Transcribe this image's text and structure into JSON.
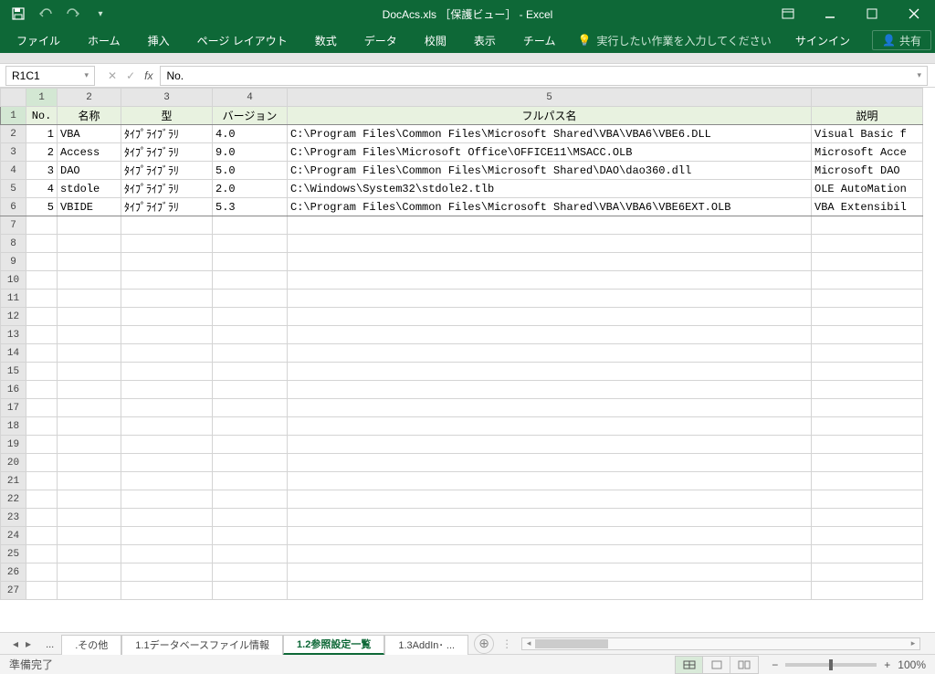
{
  "title": "DocAcs.xls ［保護ビュー］ - Excel",
  "qat": {
    "save": "保存",
    "undo": "元に戻す",
    "redo": "やり直し"
  },
  "ribbon": {
    "tabs": [
      "ファイル",
      "ホーム",
      "挿入",
      "ページ レイアウト",
      "数式",
      "データ",
      "校閲",
      "表示",
      "チーム"
    ],
    "tellme": "実行したい作業を入力してください",
    "signin": "サインイン",
    "share": "共有"
  },
  "namebox": "R1C1",
  "formula": "No.",
  "columns": [
    "1",
    "2",
    "3",
    "4",
    "5"
  ],
  "headers": {
    "no": "No.",
    "name": "名称",
    "type": "型",
    "ver": "バージョン",
    "path": "フルパス名",
    "desc": "説明"
  },
  "rows": [
    {
      "no": "1",
      "name": "VBA",
      "type": "ﾀｲﾌﾟﾗｲﾌﾞﾗﾘ",
      "ver": "4.0",
      "path": "C:\\Program Files\\Common Files\\Microsoft Shared\\VBA\\VBA6\\VBE6.DLL",
      "desc": "Visual Basic f"
    },
    {
      "no": "2",
      "name": "Access",
      "type": "ﾀｲﾌﾟﾗｲﾌﾞﾗﾘ",
      "ver": "9.0",
      "path": "C:\\Program Files\\Microsoft Office\\OFFICE11\\MSACC.OLB",
      "desc": "Microsoft Acce"
    },
    {
      "no": "3",
      "name": "DAO",
      "type": "ﾀｲﾌﾟﾗｲﾌﾞﾗﾘ",
      "ver": "5.0",
      "path": "C:\\Program Files\\Common Files\\Microsoft Shared\\DAO\\dao360.dll",
      "desc": "Microsoft DAO"
    },
    {
      "no": "4",
      "name": "stdole",
      "type": "ﾀｲﾌﾟﾗｲﾌﾞﾗﾘ",
      "ver": "2.0",
      "path": "C:\\Windows\\System32\\stdole2.tlb",
      "desc": "OLE AutoMation"
    },
    {
      "no": "5",
      "name": "VBIDE",
      "type": "ﾀｲﾌﾟﾗｲﾌﾞﾗﾘ",
      "ver": "5.3",
      "path": "C:\\Program Files\\Common Files\\Microsoft Shared\\VBA\\VBA6\\VBE6EXT.OLB",
      "desc": "VBA Extensibil"
    }
  ],
  "sheets": {
    "overflow": "...",
    "s1": ".その他",
    "s2": "1.1データベースファイル情報",
    "s3": "1.2参照設定一覧",
    "s4": "1.3AddIn･ ..."
  },
  "status": "準備完了",
  "zoom": "100%"
}
